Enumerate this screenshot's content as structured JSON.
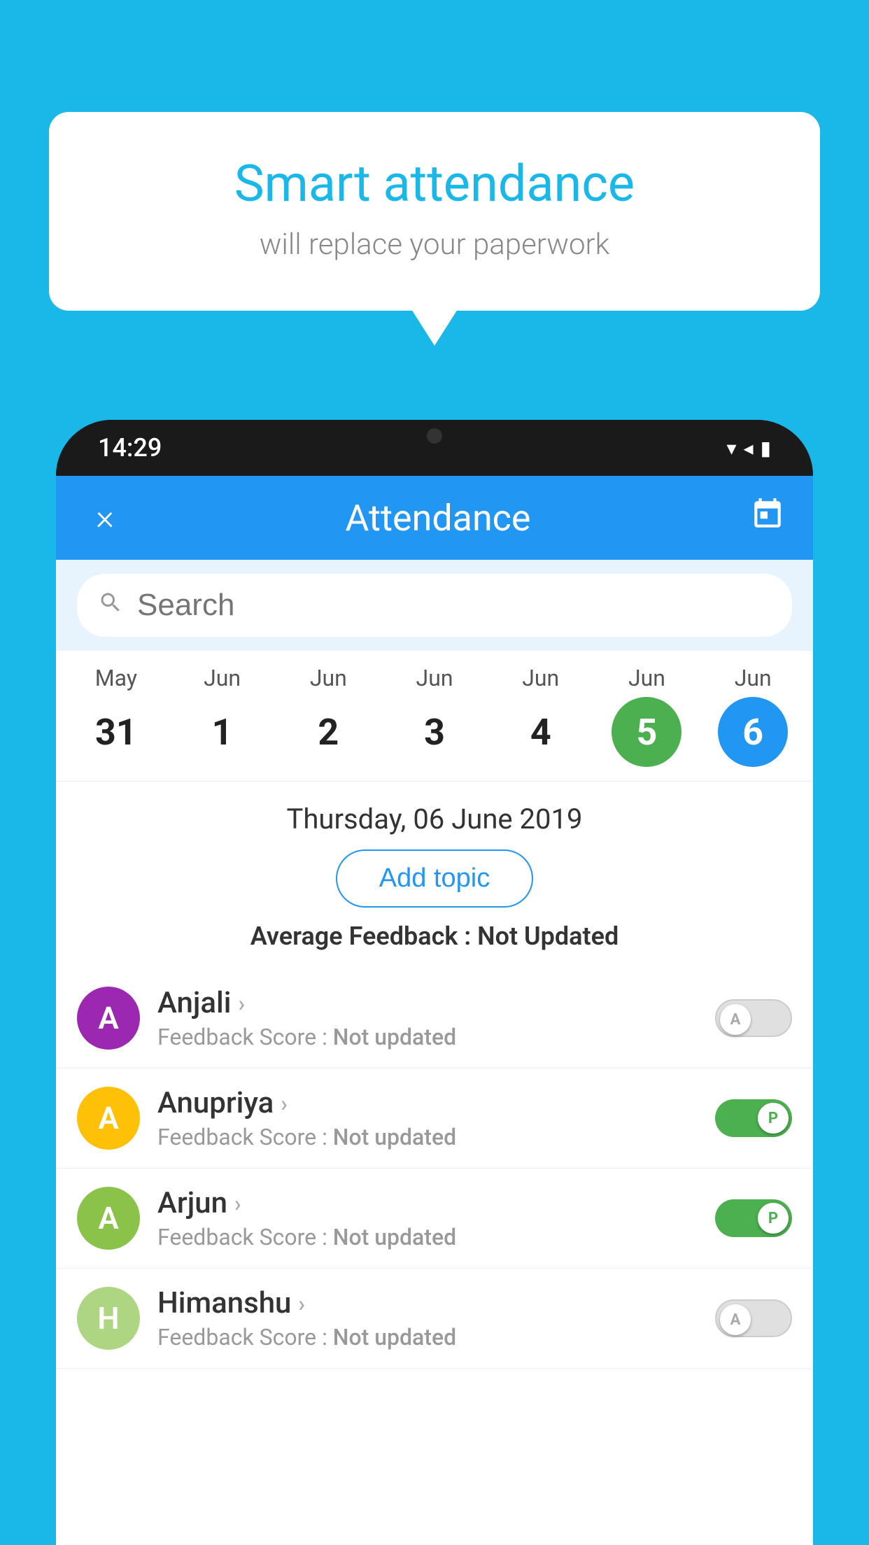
{
  "background_color": "#1ab8e8",
  "speech_bubble": {
    "title": "Smart attendance",
    "subtitle": "will replace your paperwork"
  },
  "phone": {
    "status_bar": {
      "time": "14:29",
      "wifi": "▾",
      "signal": "▲",
      "battery": "▮"
    },
    "header": {
      "close_label": "×",
      "title": "Attendance",
      "calendar_icon": "📅"
    },
    "search": {
      "placeholder": "Search"
    },
    "calendar": {
      "days": [
        {
          "month": "May",
          "date": "31",
          "state": "normal"
        },
        {
          "month": "Jun",
          "date": "1",
          "state": "normal"
        },
        {
          "month": "Jun",
          "date": "2",
          "state": "normal"
        },
        {
          "month": "Jun",
          "date": "3",
          "state": "normal"
        },
        {
          "month": "Jun",
          "date": "4",
          "state": "normal"
        },
        {
          "month": "Jun",
          "date": "5",
          "state": "today"
        },
        {
          "month": "Jun",
          "date": "6",
          "state": "selected"
        }
      ]
    },
    "selected_date": "Thursday, 06 June 2019",
    "add_topic_label": "Add topic",
    "avg_feedback_label": "Average Feedback : ",
    "avg_feedback_value": "Not Updated",
    "students": [
      {
        "name": "Anjali",
        "avatar_letter": "A",
        "avatar_color": "#9c27b0",
        "feedback_label": "Feedback Score : ",
        "feedback_value": "Not updated",
        "toggle_state": "off",
        "toggle_letter": "A"
      },
      {
        "name": "Anupriya",
        "avatar_letter": "A",
        "avatar_color": "#ffc107",
        "feedback_label": "Feedback Score : ",
        "feedback_value": "Not updated",
        "toggle_state": "on",
        "toggle_letter": "P"
      },
      {
        "name": "Arjun",
        "avatar_letter": "A",
        "avatar_color": "#8bc34a",
        "feedback_label": "Feedback Score : ",
        "feedback_value": "Not updated",
        "toggle_state": "on",
        "toggle_letter": "P"
      },
      {
        "name": "Himanshu",
        "avatar_letter": "H",
        "avatar_color": "#aed581",
        "feedback_label": "Feedback Score : ",
        "feedback_value": "Not updated",
        "toggle_state": "off",
        "toggle_letter": "A"
      }
    ]
  }
}
